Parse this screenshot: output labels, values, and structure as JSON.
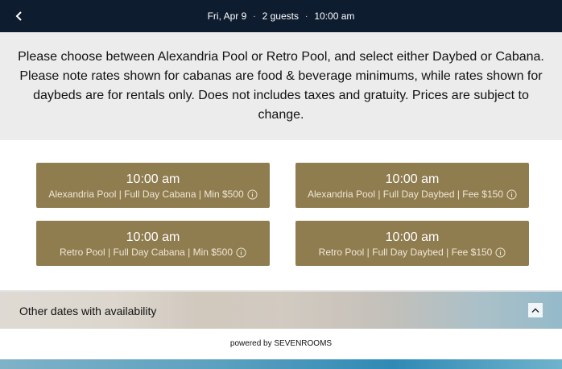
{
  "header": {
    "date": "Fri, Apr 9",
    "guests": "2 guests",
    "time": "10:00 am",
    "separator": "·",
    "background_color": "#0e1c2f"
  },
  "notice": {
    "text": "Please choose between Alexandria Pool or Retro Pool, and select either Daybed or Cabana. Please note rates shown for cabanas are food & beverage minimums, while rates shown for daybeds are for rentals only. Does not includes taxes and gratuity. Prices are subject to change."
  },
  "slots": [
    {
      "time": "10:00 am",
      "description": "Alexandria Pool | Full Day Cabana | Min $500"
    },
    {
      "time": "10:00 am",
      "description": "Alexandria Pool | Full Day Daybed | Fee $150"
    },
    {
      "time": "10:00 am",
      "description": "Retro Pool | Full Day Cabana | Min $500"
    },
    {
      "time": "10:00 am",
      "description": "Retro Pool | Full Day Daybed | Fee $150"
    }
  ],
  "slot_color": "#8f7c4f",
  "availability": {
    "label": "Other dates with availability",
    "chevron_icon": "chevron-up-icon"
  },
  "footer": {
    "powered_by": "powered by SEVENROOMS"
  },
  "icons": {
    "back": "chevron-left-icon",
    "info": "info-circle-icon"
  }
}
